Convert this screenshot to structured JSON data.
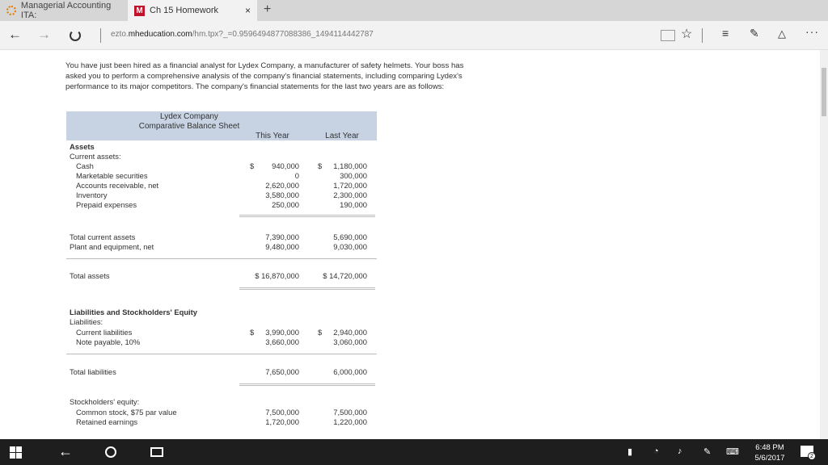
{
  "browser": {
    "tabs": [
      {
        "title": "Managerial Accounting ITA:",
        "active": false
      },
      {
        "title": "Ch 15 Homework",
        "favicon": "M",
        "active": true
      }
    ],
    "new_tab_label": "+",
    "close_label": "×",
    "address": {
      "prefix": "ezto.",
      "domain": "mheducation.com",
      "path": "/hm.tpx?_=0.9596494877088386_1494114442787"
    }
  },
  "page": {
    "intro": "You have just been hired as a financial analyst for Lydex Company, a manufacturer of safety helmets. Your boss has asked you to perform a comprehensive analysis of the company's financial statements, including comparing Lydex's performance to its major competitors. The company's financial statements for the last two years are as follows:",
    "statement": {
      "company": "Lydex Company",
      "title": "Comparative Balance Sheet",
      "col_this": "This Year",
      "col_last": "Last Year",
      "assets_heading": "Assets",
      "current_assets_heading": "Current assets:",
      "cash_label": "Cash",
      "cash_this": "940,000",
      "cash_last": "1,180,000",
      "marketable_label": "Marketable securities",
      "marketable_this": "0",
      "marketable_last": "300,000",
      "ar_label": "Accounts receivable, net",
      "ar_this": "2,620,000",
      "ar_last": "1,720,000",
      "inventory_label": "Inventory",
      "inventory_this": "3,580,000",
      "inventory_last": "2,300,000",
      "prepaid_label": "Prepaid expenses",
      "prepaid_this": "250,000",
      "prepaid_last": "190,000",
      "tca_label": "Total current assets",
      "tca_this": "7,390,000",
      "tca_last": "5,690,000",
      "ppe_label": "Plant and equipment, net",
      "ppe_this": "9,480,000",
      "ppe_last": "9,030,000",
      "ta_label": "Total assets",
      "ta_this": "$ 16,870,000",
      "ta_last": "$ 14,720,000",
      "liab_heading": "Liabilities and Stockholders' Equity",
      "liabilities_heading": "Liabilities:",
      "cl_label": "Current liabilities",
      "cl_this": "3,990,000",
      "cl_last": "2,940,000",
      "np_label": "Note payable, 10%",
      "np_this": "3,660,000",
      "np_last": "3,060,000",
      "tl_label": "Total liabilities",
      "tl_this": "7,650,000",
      "tl_last": "6,000,000",
      "se_heading": "Stockholders' equity:",
      "cs_label": "Common stock, $75 par value",
      "cs_this": "7,500,000",
      "cs_last": "7,500,000",
      "re_label": "Retained earnings",
      "re_this": "1,720,000",
      "re_last": "1,220,000",
      "dollar": "$"
    }
  },
  "taskbar": {
    "time": "6:48 PM",
    "date": "5/6/2017",
    "notification_count": "2"
  }
}
